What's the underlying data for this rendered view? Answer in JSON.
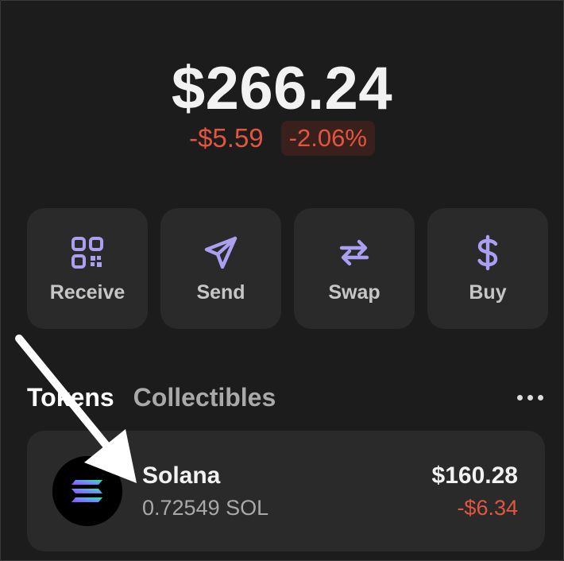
{
  "portfolio": {
    "balance": "$266.24",
    "change_amount": "-$5.59",
    "change_percent": "-2.06%"
  },
  "actions": [
    {
      "label": "Receive",
      "icon": "qr-code-icon"
    },
    {
      "label": "Send",
      "icon": "send-icon"
    },
    {
      "label": "Swap",
      "icon": "swap-icon"
    },
    {
      "label": "Buy",
      "icon": "dollar-icon"
    }
  ],
  "tabs": {
    "tokens": "Tokens",
    "collectibles": "Collectibles",
    "more_icon": "more-horizontal-icon"
  },
  "tokens": [
    {
      "name": "Solana",
      "amount": "0.72549 SOL",
      "value": "$160.28",
      "change": "-$6.34",
      "icon": "solana-logo"
    }
  ],
  "colors": {
    "background": "#1c1c1c",
    "card": "#2a2a2a",
    "accent_purple": "#ab9ff2",
    "negative": "#e2563f",
    "negative_bg": "#3a201c"
  }
}
